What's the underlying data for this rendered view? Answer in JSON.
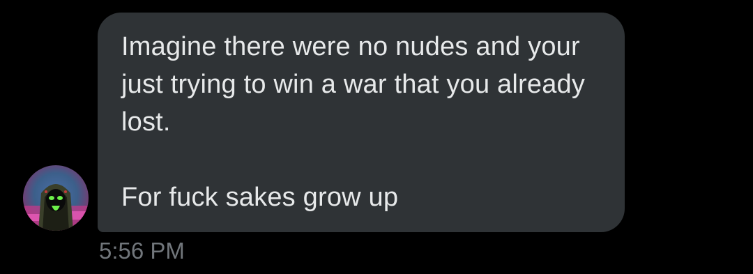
{
  "conversation": {
    "message": {
      "paragraph_1": "Imagine there were no nudes and your just trying to win a war that you already lost.",
      "paragraph_2": "For fuck sakes grow up",
      "timestamp": "5:56 PM"
    },
    "avatar": {
      "icon": "user-avatar-icon"
    }
  },
  "colors": {
    "background": "#000000",
    "bubble": "#2f3336",
    "message_text": "#e7e9ea",
    "timestamp_text": "#71767b"
  }
}
